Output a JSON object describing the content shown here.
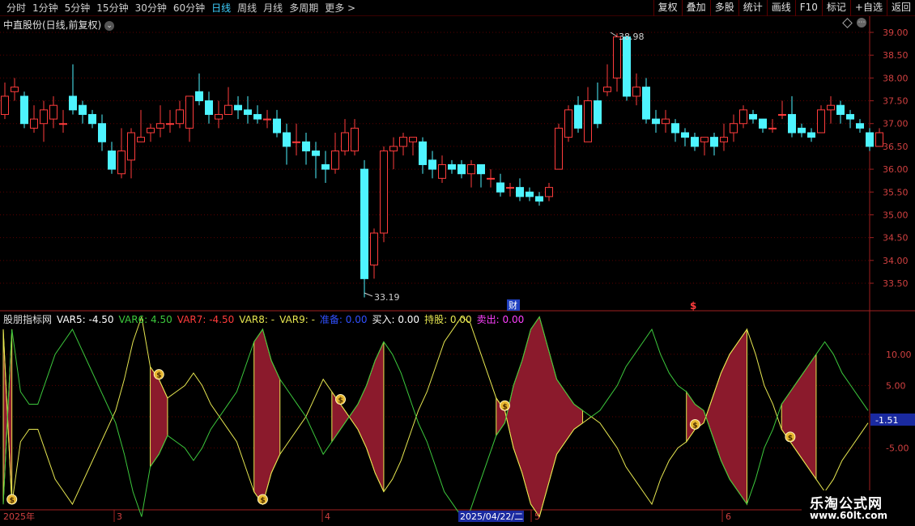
{
  "toolbar": {
    "periods": [
      "分时",
      "1分钟",
      "5分钟",
      "15分钟",
      "30分钟",
      "60分钟",
      "日线",
      "周线",
      "月线",
      "多周期",
      "更多 >"
    ],
    "active_period": "日线",
    "right_buttons": [
      "复权",
      "叠加",
      "多股",
      "统计",
      "画线",
      "F10",
      "标记",
      "+自选",
      "返回"
    ]
  },
  "main_title": "中直股份(日线,前复权)",
  "price_axis": [
    "39.00",
    "38.50",
    "38.00",
    "37.50",
    "37.00",
    "36.50",
    "36.00",
    "35.50",
    "35.00",
    "34.50",
    "34.00",
    "33.50"
  ],
  "high_label": "38.98",
  "low_label": "33.19",
  "event_marks": {
    "cai": "财",
    "dollar": "$"
  },
  "indicator": {
    "name": "股朋指标网",
    "var5": "VAR5: -4.50",
    "var6": "VAR6: 4.50",
    "var7": "VAR7: -4.50",
    "var8": "VAR8: -",
    "var9": "VAR9: -",
    "zhunbei": "准备: 0.00",
    "mairu": "买入: 0.00",
    "chigu": "持股: 0.00",
    "maichu": "卖出: 0.00",
    "axis": [
      "10.00",
      "5.00",
      "-5.00"
    ],
    "current_value": "-1.51"
  },
  "date_axis": {
    "year": "2025年",
    "m3": "3",
    "m4": "4",
    "cursor_date": "2025/04/22/二",
    "m5": "5",
    "m6": "6"
  },
  "watermark": {
    "line1": "乐淘公式网",
    "line2": "www.60lt.com"
  },
  "colors": {
    "up": "#ff3c3c",
    "down": "#4ef4ff",
    "fill": "#8b1a2c",
    "green": "#3cc83c",
    "yellow": "#e6e650"
  },
  "chart_data": {
    "type": "candlestick",
    "ylim": [
      33.19,
      38.98
    ],
    "candles": [
      [
        37.2,
        37.6,
        37.9,
        37.1
      ],
      [
        37.7,
        37.8,
        38.0,
        37.5
      ],
      [
        37.6,
        37.0,
        37.7,
        36.9
      ],
      [
        36.9,
        37.1,
        37.4,
        36.8
      ],
      [
        37.0,
        37.3,
        37.5,
        36.6
      ],
      [
        37.1,
        37.4,
        37.6,
        36.9
      ],
      [
        37.0,
        37.0,
        37.3,
        36.8
      ],
      [
        37.6,
        37.3,
        38.3,
        37.2
      ],
      [
        37.4,
        37.2,
        37.5,
        37.0
      ],
      [
        37.2,
        37.0,
        37.3,
        36.9
      ],
      [
        37.0,
        36.6,
        37.2,
        36.4
      ],
      [
        36.4,
        36.0,
        36.6,
        35.9
      ],
      [
        35.9,
        36.4,
        36.9,
        35.8
      ],
      [
        36.2,
        36.8,
        36.9,
        35.8
      ],
      [
        36.6,
        36.7,
        37.3,
        36.6
      ],
      [
        36.8,
        36.9,
        37.0,
        36.6
      ],
      [
        36.9,
        37.0,
        37.4,
        36.7
      ],
      [
        37.0,
        37.0,
        37.3,
        36.8
      ],
      [
        37.0,
        37.3,
        37.5,
        36.9
      ],
      [
        36.9,
        37.6,
        37.6,
        36.6
      ],
      [
        37.7,
        37.5,
        38.1,
        37.4
      ],
      [
        37.5,
        37.2,
        37.7,
        37.0
      ],
      [
        37.1,
        37.2,
        37.5,
        36.9
      ],
      [
        37.2,
        37.4,
        37.8,
        37.2
      ],
      [
        37.4,
        37.3,
        37.6,
        37.1
      ],
      [
        37.3,
        37.2,
        37.6,
        37.0
      ],
      [
        37.2,
        37.1,
        37.4,
        37.0
      ],
      [
        37.1,
        37.1,
        37.3,
        36.9
      ],
      [
        37.1,
        36.8,
        37.3,
        36.7
      ],
      [
        36.8,
        36.5,
        37.0,
        36.1
      ],
      [
        36.6,
        36.6,
        37.0,
        36.3
      ],
      [
        36.6,
        36.4,
        36.8,
        36.1
      ],
      [
        36.4,
        36.3,
        36.6,
        35.8
      ],
      [
        36.1,
        36.0,
        36.4,
        35.7
      ],
      [
        36.0,
        36.4,
        36.8,
        35.9
      ],
      [
        36.4,
        36.8,
        37.1,
        36.3
      ],
      [
        36.4,
        36.9,
        37.1,
        36.3
      ],
      [
        36.0,
        33.6,
        36.2,
        33.19
      ],
      [
        33.9,
        34.6,
        34.7,
        33.6
      ],
      [
        34.6,
        36.4,
        36.5,
        34.4
      ],
      [
        36.4,
        36.5,
        36.7,
        36.0
      ],
      [
        36.5,
        36.7,
        36.8,
        36.3
      ],
      [
        36.6,
        36.7,
        36.7,
        36.3
      ],
      [
        36.6,
        36.1,
        36.7,
        35.9
      ],
      [
        36.2,
        36.0,
        36.4,
        35.8
      ],
      [
        35.8,
        36.1,
        36.3,
        35.7
      ],
      [
        36.1,
        36.0,
        36.2,
        35.9
      ],
      [
        36.1,
        35.9,
        36.2,
        35.8
      ],
      [
        35.9,
        36.1,
        36.2,
        35.6
      ],
      [
        36.1,
        35.9,
        36.1,
        35.6
      ],
      [
        35.8,
        35.8,
        36.0,
        35.6
      ],
      [
        35.7,
        35.5,
        35.9,
        35.4
      ],
      [
        35.6,
        35.6,
        35.7,
        35.4
      ],
      [
        35.6,
        35.4,
        35.8,
        35.3
      ],
      [
        35.5,
        35.4,
        35.6,
        35.3
      ],
      [
        35.4,
        35.3,
        35.5,
        35.2
      ],
      [
        35.4,
        35.6,
        35.7,
        35.3
      ],
      [
        36.0,
        36.9,
        37.0,
        36.0
      ],
      [
        36.7,
        37.3,
        37.4,
        36.6
      ],
      [
        37.4,
        36.9,
        37.6,
        36.8
      ],
      [
        36.6,
        37.5,
        37.8,
        36.6
      ],
      [
        37.5,
        37.0,
        37.9,
        36.9
      ],
      [
        37.7,
        37.8,
        38.3,
        37.6
      ],
      [
        38.0,
        38.9,
        38.98,
        37.7
      ],
      [
        38.9,
        37.6,
        38.9,
        37.5
      ],
      [
        37.6,
        37.8,
        38.1,
        37.4
      ],
      [
        37.8,
        37.1,
        38.0,
        37.0
      ],
      [
        37.1,
        37.0,
        37.3,
        36.8
      ],
      [
        37.0,
        37.1,
        37.3,
        36.8
      ],
      [
        37.0,
        36.8,
        37.1,
        36.6
      ],
      [
        36.8,
        36.7,
        36.9,
        36.5
      ],
      [
        36.7,
        36.5,
        36.8,
        36.4
      ],
      [
        36.6,
        36.7,
        36.7,
        36.3
      ],
      [
        36.7,
        36.5,
        36.8,
        36.3
      ],
      [
        36.6,
        36.7,
        37.0,
        36.4
      ],
      [
        36.8,
        37.0,
        37.2,
        36.6
      ],
      [
        37.0,
        37.3,
        37.4,
        36.9
      ],
      [
        37.2,
        37.1,
        37.3,
        37.0
      ],
      [
        37.1,
        36.9,
        37.1,
        36.8
      ],
      [
        36.9,
        36.9,
        37.1,
        36.8
      ],
      [
        37.2,
        37.2,
        37.5,
        37.1
      ],
      [
        37.2,
        36.8,
        37.6,
        36.7
      ],
      [
        36.9,
        36.8,
        37.0,
        36.7
      ],
      [
        36.8,
        36.7,
        36.9,
        36.6
      ],
      [
        36.8,
        37.3,
        37.4,
        36.8
      ],
      [
        37.3,
        37.4,
        37.6,
        37.0
      ],
      [
        37.4,
        37.2,
        37.5,
        37.0
      ],
      [
        37.2,
        37.1,
        37.3,
        36.9
      ],
      [
        37.0,
        36.9,
        37.1,
        36.8
      ],
      [
        36.8,
        36.5,
        36.9,
        36.4
      ],
      [
        36.5,
        36.8,
        36.9,
        36.5
      ]
    ],
    "indicator_series": {
      "yellow": [
        14,
        -14,
        -4,
        -2,
        -2,
        -6,
        -10,
        -12,
        -14,
        -11,
        -8,
        -5,
        -2,
        1,
        6,
        12,
        16,
        8,
        6,
        3,
        4,
        5,
        7,
        5,
        2,
        0,
        -2,
        -4,
        -8,
        -12,
        -14,
        -9,
        -6,
        -4,
        -2,
        0,
        3,
        6,
        4,
        2,
        0,
        -2,
        -5,
        -9,
        -12,
        -10,
        -7,
        -3,
        1,
        4,
        8,
        12,
        14,
        16,
        15,
        11,
        7,
        3,
        1,
        -5,
        -9,
        -14,
        -16,
        -11,
        -6,
        -4,
        -2,
        -1,
        0,
        -1,
        -3,
        -5,
        -8,
        -10,
        -12,
        -14,
        -10,
        -7,
        -5,
        -4,
        -2,
        -1,
        3,
        7,
        10,
        12,
        14,
        10,
        5,
        2,
        -2,
        -4,
        -6,
        -8,
        -10,
        -12,
        -10,
        -7,
        -5,
        -3,
        -1
      ]
    }
  }
}
